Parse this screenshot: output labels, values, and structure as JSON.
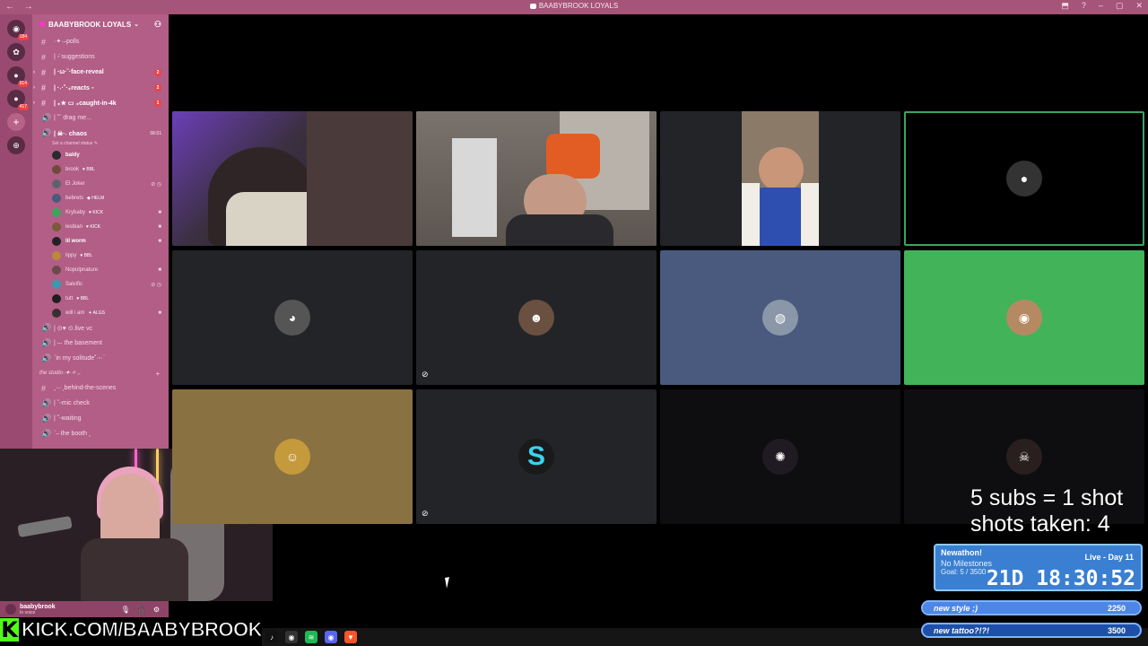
{
  "window": {
    "title": "BAABYBROOK LOYALS",
    "nav": "← →",
    "controls": [
      "⬒",
      "?",
      "–",
      "▢",
      "✕"
    ]
  },
  "rail": {
    "servers": [
      {
        "icon": "discord-icon",
        "glyph": "◉",
        "count": "184"
      },
      {
        "icon": "server-icon",
        "glyph": "✿",
        "count": ""
      },
      {
        "icon": "server-icon",
        "glyph": "●",
        "count": "914"
      },
      {
        "icon": "server-icon",
        "glyph": "●",
        "count": "417"
      },
      {
        "icon": "add-server-icon",
        "glyph": "+",
        "count": ""
      },
      {
        "icon": "explore-icon",
        "glyph": "⊕",
        "count": ""
      }
    ]
  },
  "sidebar": {
    "server_name": "BAABYBROOK LOYALS",
    "channels": [
      {
        "glyph": "#",
        "label": "·✦·⎯polls",
        "badge": "",
        "unread": false
      },
      {
        "glyph": "#",
        "label": "|  ᵕ̈ suggestions",
        "badge": "",
        "unread": false
      },
      {
        "glyph": "#",
        "label": "| ·ω·˘·face-reveal",
        "badge": "2",
        "unread": true
      },
      {
        "glyph": "#",
        "label": "| ·˖·˚·₊reacts ᵕ",
        "badge": "2",
        "unread": true
      },
      {
        "glyph": "#",
        "label": "| ₊★ ▭ ₊caught-in-4k",
        "badge": "1",
        "unread": true
      },
      {
        "glyph": "🔊",
        "label": "| ˘ˆ drag me...",
        "badge": "",
        "unread": false
      }
    ],
    "voice_channel": {
      "label": "| ☠·˖ chaos",
      "time": "58:51",
      "status": "Set a channel status ✎"
    },
    "voice_users": [
      {
        "name": "baldy",
        "tag": "",
        "color": "#2b2b2b",
        "icon": "",
        "bright": true
      },
      {
        "name": "brook",
        "tag": "♥ BBL",
        "color": "#6d4a3c",
        "icon": "",
        "bright": false
      },
      {
        "name": "El Joker",
        "tag": "",
        "color": "#5d6270",
        "icon": "⊘ ◷",
        "bright": false
      },
      {
        "name": "bebrets",
        "tag": "◆ HELM",
        "color": "#4a5a7a",
        "icon": "",
        "bright": false
      },
      {
        "name": "Krybaby",
        "tag": "♥ KICK",
        "color": "#3ba55d",
        "icon": "■",
        "bright": false
      },
      {
        "name": "lesbian",
        "tag": "♥ KICK",
        "color": "#7a5a3a",
        "icon": "■",
        "bright": false
      },
      {
        "name": "lil worm",
        "tag": "",
        "color": "#222",
        "icon": "■",
        "bright": true
      },
      {
        "name": "lippy",
        "tag": "♥ BBL",
        "color": "#b88a3a",
        "icon": "",
        "bright": false
      },
      {
        "name": "Nopulpnature",
        "tag": "",
        "color": "#6a4a4a",
        "icon": "■",
        "bright": false
      },
      {
        "name": "Salvific",
        "tag": "",
        "color": "#3a9ab0",
        "icon": "⊘ ◷",
        "bright": false
      },
      {
        "name": "tutt",
        "tag": "♥ BBL",
        "color": "#1e1e1e",
        "icon": "",
        "bright": false
      },
      {
        "name": "will i am",
        "tag": "✦ ALGS",
        "color": "#3a3030",
        "icon": "■",
        "bright": false
      }
    ],
    "more_channels": [
      {
        "glyph": "🔊",
        "label": "| ⊙♥ ⊙.live vc"
      },
      {
        "glyph": "🔊",
        "label": "| ⎯˖ the basement"
      },
      {
        "glyph": "🔊",
        "label": "ˋin my solitude˚·ᵕ·ˊ"
      }
    ],
    "category": "the studio⎯✦·✧ ⌄",
    "studio_channels": [
      {
        "glyph": "#",
        "label": "˳·˖·˳behind-the-scenes"
      },
      {
        "glyph": "🔊",
        "label": "| ˘ᵕmic check"
      },
      {
        "glyph": "🔊",
        "label": "| ˚ᵕwaiting"
      },
      {
        "glyph": "🔊",
        "label": "ˋ⎯ the booth ˳"
      }
    ]
  },
  "userbar": {
    "name": "baabybrook",
    "status": "In voice",
    "controls": [
      "🎙",
      "🎧",
      "⚙"
    ]
  },
  "kick_banner": {
    "k": "K",
    "url": "KICK.COM/BAABYBROOK"
  },
  "taskbar": [
    {
      "icon": "tiktok-icon",
      "glyph": "♪",
      "color": "#111"
    },
    {
      "icon": "obs-icon",
      "glyph": "◉",
      "color": "#333"
    },
    {
      "icon": "spotify-icon",
      "glyph": "≋",
      "color": "#1db954"
    },
    {
      "icon": "discord-icon",
      "glyph": "◉",
      "color": "#5865f2"
    },
    {
      "icon": "brave-icon",
      "glyph": "▼",
      "color": "#fb542b"
    }
  ],
  "tiles": [
    {
      "kind": "cam",
      "bg": "#3b2f40",
      "speaking": false,
      "muted": false,
      "avatar": ""
    },
    {
      "kind": "cam",
      "bg": "#6d6660",
      "speaking": true,
      "muted": false,
      "avatar": ""
    },
    {
      "kind": "cam",
      "bg": "#232428",
      "speaking": false,
      "muted": false,
      "avatar": ""
    },
    {
      "kind": "avatar",
      "bg": "#000",
      "speaking": true,
      "muted": false,
      "avatar": "#333",
      "glyph": "●"
    },
    {
      "kind": "avatar",
      "bg": "#232428",
      "speaking": false,
      "muted": false,
      "avatar": "#555",
      "glyph": "◕"
    },
    {
      "kind": "avatar",
      "bg": "#232428",
      "speaking": false,
      "muted": true,
      "avatar": "#6a5040",
      "glyph": "☻"
    },
    {
      "kind": "avatar",
      "bg": "#4a5a7e",
      "speaking": false,
      "muted": false,
      "avatar": "#8a97a8",
      "glyph": "◍"
    },
    {
      "kind": "avatar",
      "bg": "#43b35a",
      "speaking": false,
      "muted": false,
      "avatar": "#b58a62",
      "glyph": "◉"
    },
    {
      "kind": "avatar",
      "bg": "#8a7142",
      "speaking": false,
      "muted": false,
      "avatar": "#c49a3c",
      "glyph": "☺"
    },
    {
      "kind": "avatar",
      "bg": "#232428",
      "speaking": false,
      "muted": true,
      "avatar": "#1a1a1a",
      "glyph": "S"
    },
    {
      "kind": "avatar",
      "bg": "#0e0e10",
      "speaking": false,
      "muted": false,
      "avatar": "#201a22",
      "glyph": "✺"
    },
    {
      "kind": "avatar",
      "bg": "#0e0e10",
      "speaking": false,
      "muted": false,
      "avatar": "#2a1f1f",
      "glyph": "☠"
    }
  ],
  "overlay": {
    "shots_line1": "5 subs = 1 shot",
    "shots_line2": "shots taken: 4",
    "subathon": {
      "title": "Newathon!",
      "milestones": "No Milestones",
      "goal": "Goal: 5 / 3500",
      "live": "Live - Day 11",
      "countdown": "21D 18:30:52"
    },
    "goals": [
      {
        "label": "new style ;)",
        "value": "2250",
        "progress": 1.0
      },
      {
        "label": "new tattoo?!?!",
        "value": "3500",
        "progress": 0.0
      }
    ]
  }
}
